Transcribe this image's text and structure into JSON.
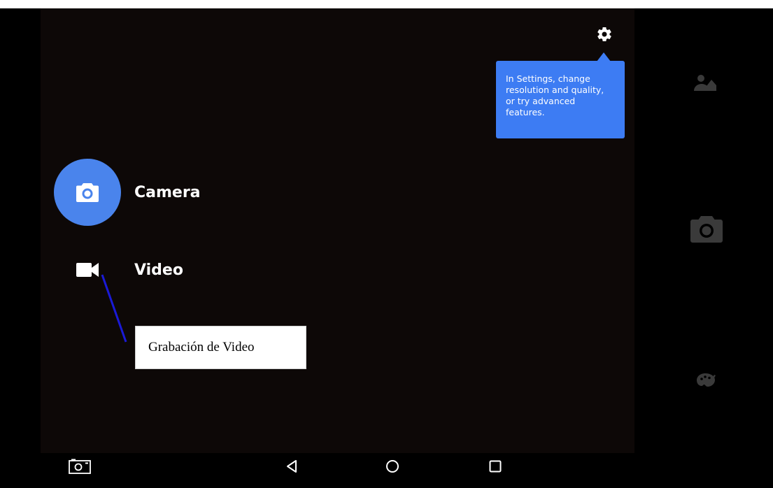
{
  "settings": {
    "icon": "gear-icon",
    "tooltip_text": "In Settings, change resolution and quality, or try advanced features."
  },
  "modes": [
    {
      "label": "Camera",
      "icon": "camera-icon",
      "active": true
    },
    {
      "label": "Video",
      "icon": "video-camera-icon",
      "active": false
    }
  ],
  "right_rail": {
    "gallery_icon": "gallery-icon",
    "shutter_icon": "camera-shutter-icon",
    "filters_icon": "palette-icon"
  },
  "annotation": {
    "text": "Grabación de Video",
    "line_color": "#1a1ad6"
  },
  "nav": {
    "screenshot_icon": "screenshot-icon",
    "back_icon": "back-icon",
    "home_icon": "home-icon",
    "recents_icon": "recents-icon"
  },
  "colors": {
    "accent": "#3d7cf3",
    "mode_active": "#4a84ec",
    "viewfinder": "#0d0807"
  }
}
